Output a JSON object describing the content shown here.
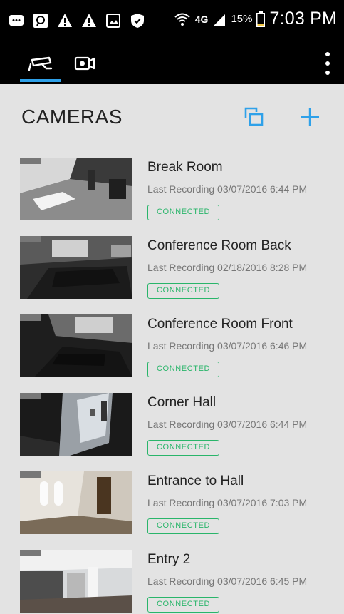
{
  "status_bar": {
    "battery": "15%",
    "network": "4G",
    "time": "7:03 PM"
  },
  "tabs": [
    {
      "name": "cameras-tab-icon",
      "active": true
    },
    {
      "name": "recordings-tab-icon",
      "active": false
    }
  ],
  "header": {
    "title": "CAMERAS"
  },
  "cameras": [
    {
      "name": "Break Room",
      "last_recording": "Last Recording 03/07/2016 6:44 PM",
      "status": "CONNECTED"
    },
    {
      "name": "Conference Room Back",
      "last_recording": "Last Recording 02/18/2016 8:28 PM",
      "status": "CONNECTED"
    },
    {
      "name": "Conference Room Front",
      "last_recording": "Last Recording 03/07/2016 6:46 PM",
      "status": "CONNECTED"
    },
    {
      "name": "Corner Hall",
      "last_recording": "Last Recording 03/07/2016 6:44 PM",
      "status": "CONNECTED"
    },
    {
      "name": "Entrance to Hall",
      "last_recording": "Last Recording 03/07/2016 7:03 PM",
      "status": "CONNECTED"
    },
    {
      "name": "Entry 2",
      "last_recording": "Last Recording 03/07/2016 6:45 PM",
      "status": "CONNECTED"
    }
  ],
  "colors": {
    "accent": "#2fa1e9",
    "connected": "#29b56a",
    "background": "#e3e3e3"
  }
}
